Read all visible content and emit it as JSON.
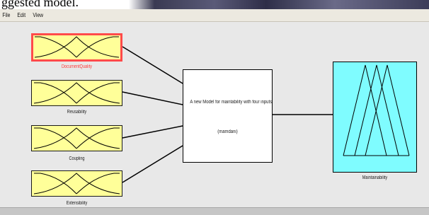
{
  "header": {
    "caption_fragment": "ggested model."
  },
  "menu": {
    "items": [
      "File",
      "Edit",
      "View"
    ]
  },
  "inputs": [
    {
      "name": "DocumentQuality",
      "selected": true
    },
    {
      "name": "Reusability",
      "selected": false
    },
    {
      "name": "Coupling",
      "selected": false
    },
    {
      "name": "Extensibility",
      "selected": false
    }
  ],
  "rules": {
    "title": "A new Model for maintability with four inputs",
    "type": "(mamdani)"
  },
  "output": {
    "name": "Maintainability"
  },
  "colors": {
    "input_fill": "#ffff99",
    "output_fill": "#7ffcff",
    "selected_border": "#ff4a4a",
    "canvas": "#e8e8e8"
  }
}
